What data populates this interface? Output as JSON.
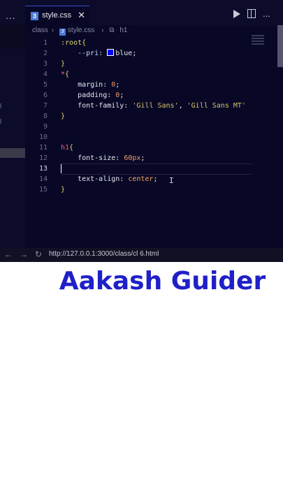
{
  "explorer": {
    "dots": "..."
  },
  "tab": {
    "label": "style.css",
    "icon": "css-file-icon",
    "close": "✕"
  },
  "toolbar": {
    "run_icon": "play-icon",
    "split_icon": "split-editor-icon",
    "more_icon": "more-icon",
    "more": "..."
  },
  "breadcrumb": [
    "class",
    "style.css",
    "h1"
  ],
  "lines": [
    {
      "n": "1",
      "tokens": [
        {
          "c": "t-sel",
          "t": ":root"
        },
        {
          "c": "t-brace",
          "t": "{"
        }
      ]
    },
    {
      "n": "2",
      "tokens": [
        {
          "c": "t-var",
          "t": "    --pri: "
        },
        {
          "c": "swatch",
          "t": ""
        },
        {
          "c": "t-prop",
          "t": "blue;"
        }
      ]
    },
    {
      "n": "3",
      "tokens": [
        {
          "c": "t-brace",
          "t": "}"
        }
      ]
    },
    {
      "n": "4",
      "tokens": [
        {
          "c": "t-kw",
          "t": "*"
        },
        {
          "c": "t-brace",
          "t": "{"
        }
      ]
    },
    {
      "n": "5",
      "tokens": [
        {
          "c": "t-prop",
          "t": "    margin: "
        },
        {
          "c": "t-num",
          "t": "0"
        },
        {
          "c": "t-prop",
          "t": ";"
        }
      ]
    },
    {
      "n": "6",
      "tokens": [
        {
          "c": "t-prop",
          "t": "    padding: "
        },
        {
          "c": "t-num",
          "t": "0"
        },
        {
          "c": "t-prop",
          "t": ";"
        }
      ]
    },
    {
      "n": "7",
      "tokens": [
        {
          "c": "t-prop",
          "t": "    font-family: "
        },
        {
          "c": "t-str",
          "t": "'Gill Sans'"
        },
        {
          "c": "t-prop",
          "t": ", "
        },
        {
          "c": "t-str",
          "t": "'Gill Sans MT'"
        }
      ]
    },
    {
      "n": "8",
      "tokens": [
        {
          "c": "t-brace",
          "t": "}"
        }
      ]
    },
    {
      "n": "9",
      "tokens": []
    },
    {
      "n": "10",
      "tokens": []
    },
    {
      "n": "11",
      "tokens": [
        {
          "c": "t-tag",
          "t": "h1"
        },
        {
          "c": "t-brace",
          "t": "{"
        }
      ]
    },
    {
      "n": "12",
      "tokens": [
        {
          "c": "t-prop",
          "t": "    font-size: "
        },
        {
          "c": "t-num",
          "t": "60px"
        },
        {
          "c": "t-prop",
          "t": ";"
        }
      ]
    },
    {
      "n": "13",
      "tokens": []
    },
    {
      "n": "14",
      "tokens": [
        {
          "c": "t-prop",
          "t": "    text-align: "
        },
        {
          "c": "t-val",
          "t": "center"
        },
        {
          "c": "t-prop",
          "t": ";"
        }
      ]
    },
    {
      "n": "15",
      "tokens": [
        {
          "c": "t-brace",
          "t": "}"
        }
      ]
    }
  ],
  "active_line": 13,
  "browser": {
    "back": "←",
    "forward": "→",
    "reload": "↻",
    "url": "http://127.0.0.1:3000/class/cl 6.html"
  },
  "page": {
    "heading": "Aakash Guider"
  },
  "colors": {
    "editor_bg": "#080826",
    "heading": "#1f20c8"
  }
}
